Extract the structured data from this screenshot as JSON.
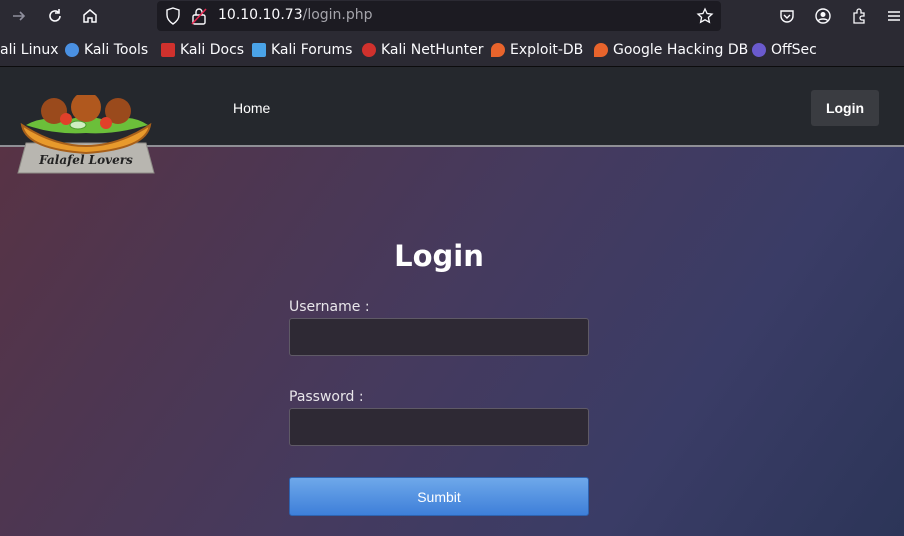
{
  "browser": {
    "url_host": "10.10.10.73",
    "url_path": "/login.php"
  },
  "bookmarks": [
    {
      "label": "ali Linux",
      "icon": "kali-icon",
      "color": "#367bf0"
    },
    {
      "label": "Kali Tools",
      "icon": "kali-tools-icon",
      "color": "#4a90e2"
    },
    {
      "label": "Kali Docs",
      "icon": "kali-docs-icon",
      "color": "#d0312d"
    },
    {
      "label": "Kali Forums",
      "icon": "kali-forums-icon",
      "color": "#4aa3e8"
    },
    {
      "label": "Kali NetHunter",
      "icon": "nethunter-icon",
      "color": "#d0312d"
    },
    {
      "label": "Exploit-DB",
      "icon": "exploit-db-icon",
      "color": "#e8642c"
    },
    {
      "label": "Google Hacking DB",
      "icon": "ghdb-icon",
      "color": "#e8642c"
    },
    {
      "label": "OffSec",
      "icon": "offsec-icon",
      "color": "#6a5acd"
    }
  ],
  "nav": {
    "home_label": "Home",
    "login_label": "Login"
  },
  "logo": {
    "text": "Falafel Lovers"
  },
  "form": {
    "title": "Login",
    "username_label": "Username :",
    "username_value": "",
    "password_label": "Password :",
    "password_value": "",
    "submit_label": "Sumbit"
  }
}
